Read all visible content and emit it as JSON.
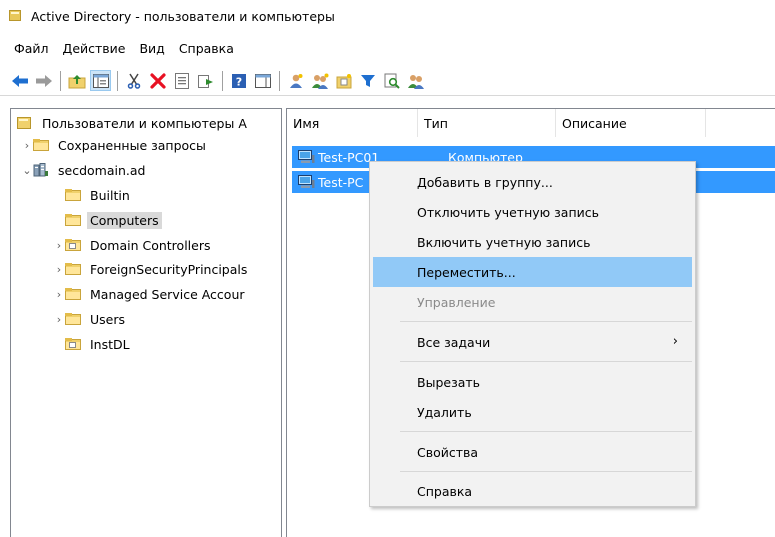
{
  "window": {
    "title": "Active Directory - пользователи и компьютеры"
  },
  "menu": [
    {
      "label": "Файл"
    },
    {
      "label": "Действие"
    },
    {
      "label": "Вид"
    },
    {
      "label": "Справка"
    }
  ],
  "toolbar": {
    "buttons": [
      "back-icon",
      "forward-icon",
      "up-folder-icon",
      "show-console-tree-icon",
      "cut-icon",
      "delete-icon",
      "properties-icon",
      "export-list-icon",
      "help-icon",
      "action-pane-icon",
      "new-user-icon",
      "new-group-icon",
      "new-ou-icon",
      "filter-icon",
      "find-icon",
      "add-to-group-icon"
    ]
  },
  "tree": {
    "root": "Пользователи и компьютеры А",
    "items": [
      {
        "label": "Сохраненные запросы"
      },
      {
        "label": "secdomain.ad"
      },
      {
        "label": "Builtin"
      },
      {
        "label": "Computers"
      },
      {
        "label": "Domain Controllers"
      },
      {
        "label": "ForeignSecurityPrincipals"
      },
      {
        "label": "Managed Service Accour"
      },
      {
        "label": "Users"
      },
      {
        "label": "InstDL"
      }
    ]
  },
  "list": {
    "columns": [
      "Имя",
      "Тип",
      "Описание"
    ],
    "rows": [
      {
        "name": "Test-PC01",
        "type": "Компьютер"
      },
      {
        "name": "Test-PC",
        "type": ""
      }
    ]
  },
  "context_menu": {
    "items": [
      {
        "label": "Добавить в группу..."
      },
      {
        "label": "Отключить учетную запись"
      },
      {
        "label": "Включить учетную запись"
      },
      {
        "label": "Переместить..."
      },
      {
        "label": "Управление"
      },
      {
        "label": "Все задачи"
      },
      {
        "label": "Вырезать"
      },
      {
        "label": "Удалить"
      },
      {
        "label": "Свойства"
      },
      {
        "label": "Справка"
      }
    ]
  },
  "colors": {
    "selection": "#3399ff",
    "menu_hover": "#91c9f7",
    "menu_bg": "#f2f2f2",
    "delete_red": "#e81123"
  }
}
